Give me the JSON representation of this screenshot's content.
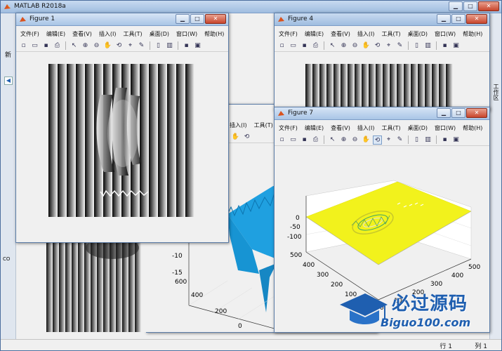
{
  "main_window": {
    "title": "MATLAB R2018a"
  },
  "menu": [
    "文件(F)",
    "编辑(E)",
    "查看(V)",
    "插入(I)",
    "工具(T)",
    "桌面(D)",
    "窗口(W)",
    "帮助(H)"
  ],
  "window_buttons": {
    "minimize": "▁",
    "maximize": "□",
    "close": "✕"
  },
  "toolbar_icons": [
    "new-figure-icon",
    "open-file-icon",
    "save-icon",
    "print-icon",
    "pointer-icon",
    "zoom-in-icon",
    "zoom-out-icon",
    "pan-icon",
    "rotate-3d-icon",
    "data-cursor-icon",
    "brush-icon",
    "link-plot-icon",
    "colorbar-icon",
    "legend-icon",
    "hide-plot-tools-icon",
    "show-plot-tools-icon"
  ],
  "figures": {
    "figure1": {
      "title": "Figure 1"
    },
    "figure4": {
      "title": "Figure 4"
    },
    "figure7": {
      "title": "Figure 7"
    }
  },
  "side_panels": {
    "left_letter": "新",
    "command_label": "CO",
    "right_label": "工作区"
  },
  "statusbar": {
    "row": "行 1",
    "col": "列 1"
  },
  "watermark": {
    "brand": "必过源码",
    "url": "Biguo100.com"
  },
  "chart_data": [
    {
      "type": "surface",
      "figure": "Figure 7",
      "zticks": [
        "0",
        "-50",
        "-100"
      ],
      "xticks": [
        "500",
        "400",
        "300",
        "200",
        "100",
        "0"
      ],
      "yticks": [
        "500",
        "400",
        "300",
        "200",
        "100",
        "0"
      ],
      "surface_color": "#f2f21c",
      "grid": true
    },
    {
      "type": "surface",
      "figure": "background figure (cyan)",
      "zticks": [
        "-10",
        "-15"
      ],
      "xticks": [
        "600",
        "400",
        "200",
        "0"
      ],
      "surface_color": "#1fa0e0",
      "grid": true
    }
  ],
  "colors": {
    "titlebar": "#a9c5e6",
    "surface_yellow": "#f2f21c",
    "surface_cyan": "#1fa0e0",
    "brand_blue": "#1f5fb0"
  }
}
